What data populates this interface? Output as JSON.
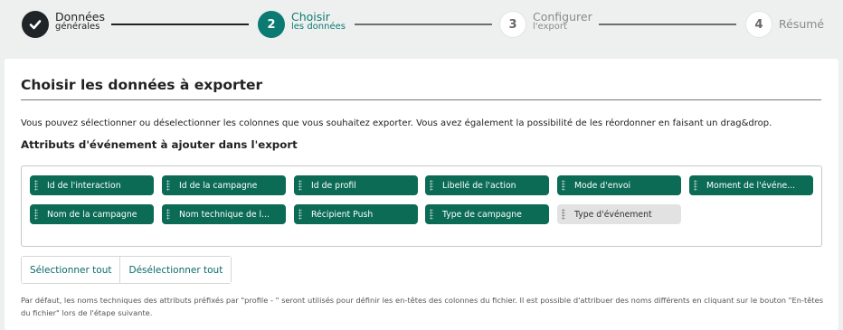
{
  "stepper": {
    "steps": [
      {
        "number": "1",
        "title": "Données",
        "subtitle": "générales",
        "state": "done"
      },
      {
        "number": "2",
        "title": "Choisir",
        "subtitle": "les données",
        "state": "active"
      },
      {
        "number": "3",
        "title": "Configurer",
        "subtitle": "l'export",
        "state": "todo"
      },
      {
        "number": "4",
        "title": "Résumé",
        "subtitle": "",
        "state": "todo"
      }
    ],
    "check_icon": "check-icon"
  },
  "card": {
    "title": "Choisir les données à exporter",
    "description": "Vous pouvez sélectionner ou déselectionner les colonnes que vous souhaitez exporter. Vous avez également la possibilité de les réordonner en faisant un drag&drop.",
    "attributes_title": "Attributs d'événement à ajouter dans l'export",
    "chips": [
      {
        "label": "Id de l'interaction",
        "selected": true
      },
      {
        "label": "Id de la campagne",
        "selected": true
      },
      {
        "label": "Id de profil",
        "selected": true
      },
      {
        "label": "Libellé de l'action",
        "selected": true
      },
      {
        "label": "Mode d'envoi",
        "selected": true
      },
      {
        "label": "Moment de l'événe...",
        "selected": true
      },
      {
        "label": "Nom de la campagne",
        "selected": true
      },
      {
        "label": "Nom technique de l...",
        "selected": true
      },
      {
        "label": "Récipient Push",
        "selected": true
      },
      {
        "label": "Type de campagne",
        "selected": true
      },
      {
        "label": "Type d'événement",
        "selected": false
      }
    ],
    "select_all_label": "Sélectionner tout",
    "deselect_all_label": "Désélectionner tout",
    "note": "Par défaut, les noms techniques des attributs préfixés par \"profile - \" seront utilisés pour définir les en-têtes des colonnes du fichier. Il est possible d'attribuer des noms différents en cliquant sur le bouton \"En-têtes du fichier\" lors de l'étape suivante."
  },
  "colors": {
    "accent": "#0b7a72",
    "chip_selected": "#0b6b55",
    "chip_unselected": "#e2e2e2",
    "done_step": "#1f2428"
  }
}
